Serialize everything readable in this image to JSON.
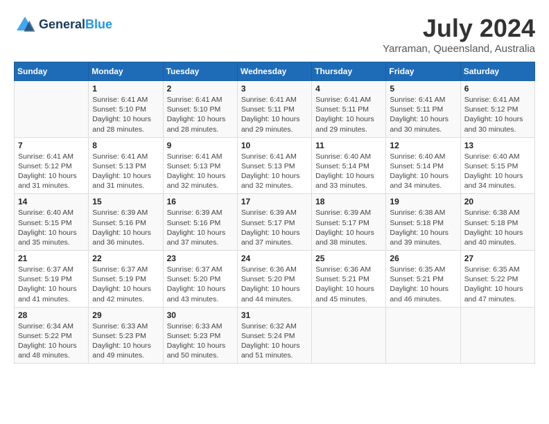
{
  "header": {
    "logo_line1": "General",
    "logo_line2": "Blue",
    "month_title": "July 2024",
    "location": "Yarraman, Queensland, Australia"
  },
  "weekdays": [
    "Sunday",
    "Monday",
    "Tuesday",
    "Wednesday",
    "Thursday",
    "Friday",
    "Saturday"
  ],
  "weeks": [
    [
      {
        "day": "",
        "info": ""
      },
      {
        "day": "1",
        "info": "Sunrise: 6:41 AM\nSunset: 5:10 PM\nDaylight: 10 hours\nand 28 minutes."
      },
      {
        "day": "2",
        "info": "Sunrise: 6:41 AM\nSunset: 5:10 PM\nDaylight: 10 hours\nand 28 minutes."
      },
      {
        "day": "3",
        "info": "Sunrise: 6:41 AM\nSunset: 5:11 PM\nDaylight: 10 hours\nand 29 minutes."
      },
      {
        "day": "4",
        "info": "Sunrise: 6:41 AM\nSunset: 5:11 PM\nDaylight: 10 hours\nand 29 minutes."
      },
      {
        "day": "5",
        "info": "Sunrise: 6:41 AM\nSunset: 5:11 PM\nDaylight: 10 hours\nand 30 minutes."
      },
      {
        "day": "6",
        "info": "Sunrise: 6:41 AM\nSunset: 5:12 PM\nDaylight: 10 hours\nand 30 minutes."
      }
    ],
    [
      {
        "day": "7",
        "info": "Sunrise: 6:41 AM\nSunset: 5:12 PM\nDaylight: 10 hours\nand 31 minutes."
      },
      {
        "day": "8",
        "info": "Sunrise: 6:41 AM\nSunset: 5:13 PM\nDaylight: 10 hours\nand 31 minutes."
      },
      {
        "day": "9",
        "info": "Sunrise: 6:41 AM\nSunset: 5:13 PM\nDaylight: 10 hours\nand 32 minutes."
      },
      {
        "day": "10",
        "info": "Sunrise: 6:41 AM\nSunset: 5:13 PM\nDaylight: 10 hours\nand 32 minutes."
      },
      {
        "day": "11",
        "info": "Sunrise: 6:40 AM\nSunset: 5:14 PM\nDaylight: 10 hours\nand 33 minutes."
      },
      {
        "day": "12",
        "info": "Sunrise: 6:40 AM\nSunset: 5:14 PM\nDaylight: 10 hours\nand 34 minutes."
      },
      {
        "day": "13",
        "info": "Sunrise: 6:40 AM\nSunset: 5:15 PM\nDaylight: 10 hours\nand 34 minutes."
      }
    ],
    [
      {
        "day": "14",
        "info": "Sunrise: 6:40 AM\nSunset: 5:15 PM\nDaylight: 10 hours\nand 35 minutes."
      },
      {
        "day": "15",
        "info": "Sunrise: 6:39 AM\nSunset: 5:16 PM\nDaylight: 10 hours\nand 36 minutes."
      },
      {
        "day": "16",
        "info": "Sunrise: 6:39 AM\nSunset: 5:16 PM\nDaylight: 10 hours\nand 37 minutes."
      },
      {
        "day": "17",
        "info": "Sunrise: 6:39 AM\nSunset: 5:17 PM\nDaylight: 10 hours\nand 37 minutes."
      },
      {
        "day": "18",
        "info": "Sunrise: 6:39 AM\nSunset: 5:17 PM\nDaylight: 10 hours\nand 38 minutes."
      },
      {
        "day": "19",
        "info": "Sunrise: 6:38 AM\nSunset: 5:18 PM\nDaylight: 10 hours\nand 39 minutes."
      },
      {
        "day": "20",
        "info": "Sunrise: 6:38 AM\nSunset: 5:18 PM\nDaylight: 10 hours\nand 40 minutes."
      }
    ],
    [
      {
        "day": "21",
        "info": "Sunrise: 6:37 AM\nSunset: 5:19 PM\nDaylight: 10 hours\nand 41 minutes."
      },
      {
        "day": "22",
        "info": "Sunrise: 6:37 AM\nSunset: 5:19 PM\nDaylight: 10 hours\nand 42 minutes."
      },
      {
        "day": "23",
        "info": "Sunrise: 6:37 AM\nSunset: 5:20 PM\nDaylight: 10 hours\nand 43 minutes."
      },
      {
        "day": "24",
        "info": "Sunrise: 6:36 AM\nSunset: 5:20 PM\nDaylight: 10 hours\nand 44 minutes."
      },
      {
        "day": "25",
        "info": "Sunrise: 6:36 AM\nSunset: 5:21 PM\nDaylight: 10 hours\nand 45 minutes."
      },
      {
        "day": "26",
        "info": "Sunrise: 6:35 AM\nSunset: 5:21 PM\nDaylight: 10 hours\nand 46 minutes."
      },
      {
        "day": "27",
        "info": "Sunrise: 6:35 AM\nSunset: 5:22 PM\nDaylight: 10 hours\nand 47 minutes."
      }
    ],
    [
      {
        "day": "28",
        "info": "Sunrise: 6:34 AM\nSunset: 5:22 PM\nDaylight: 10 hours\nand 48 minutes."
      },
      {
        "day": "29",
        "info": "Sunrise: 6:33 AM\nSunset: 5:23 PM\nDaylight: 10 hours\nand 49 minutes."
      },
      {
        "day": "30",
        "info": "Sunrise: 6:33 AM\nSunset: 5:23 PM\nDaylight: 10 hours\nand 50 minutes."
      },
      {
        "day": "31",
        "info": "Sunrise: 6:32 AM\nSunset: 5:24 PM\nDaylight: 10 hours\nand 51 minutes."
      },
      {
        "day": "",
        "info": ""
      },
      {
        "day": "",
        "info": ""
      },
      {
        "day": "",
        "info": ""
      }
    ]
  ]
}
